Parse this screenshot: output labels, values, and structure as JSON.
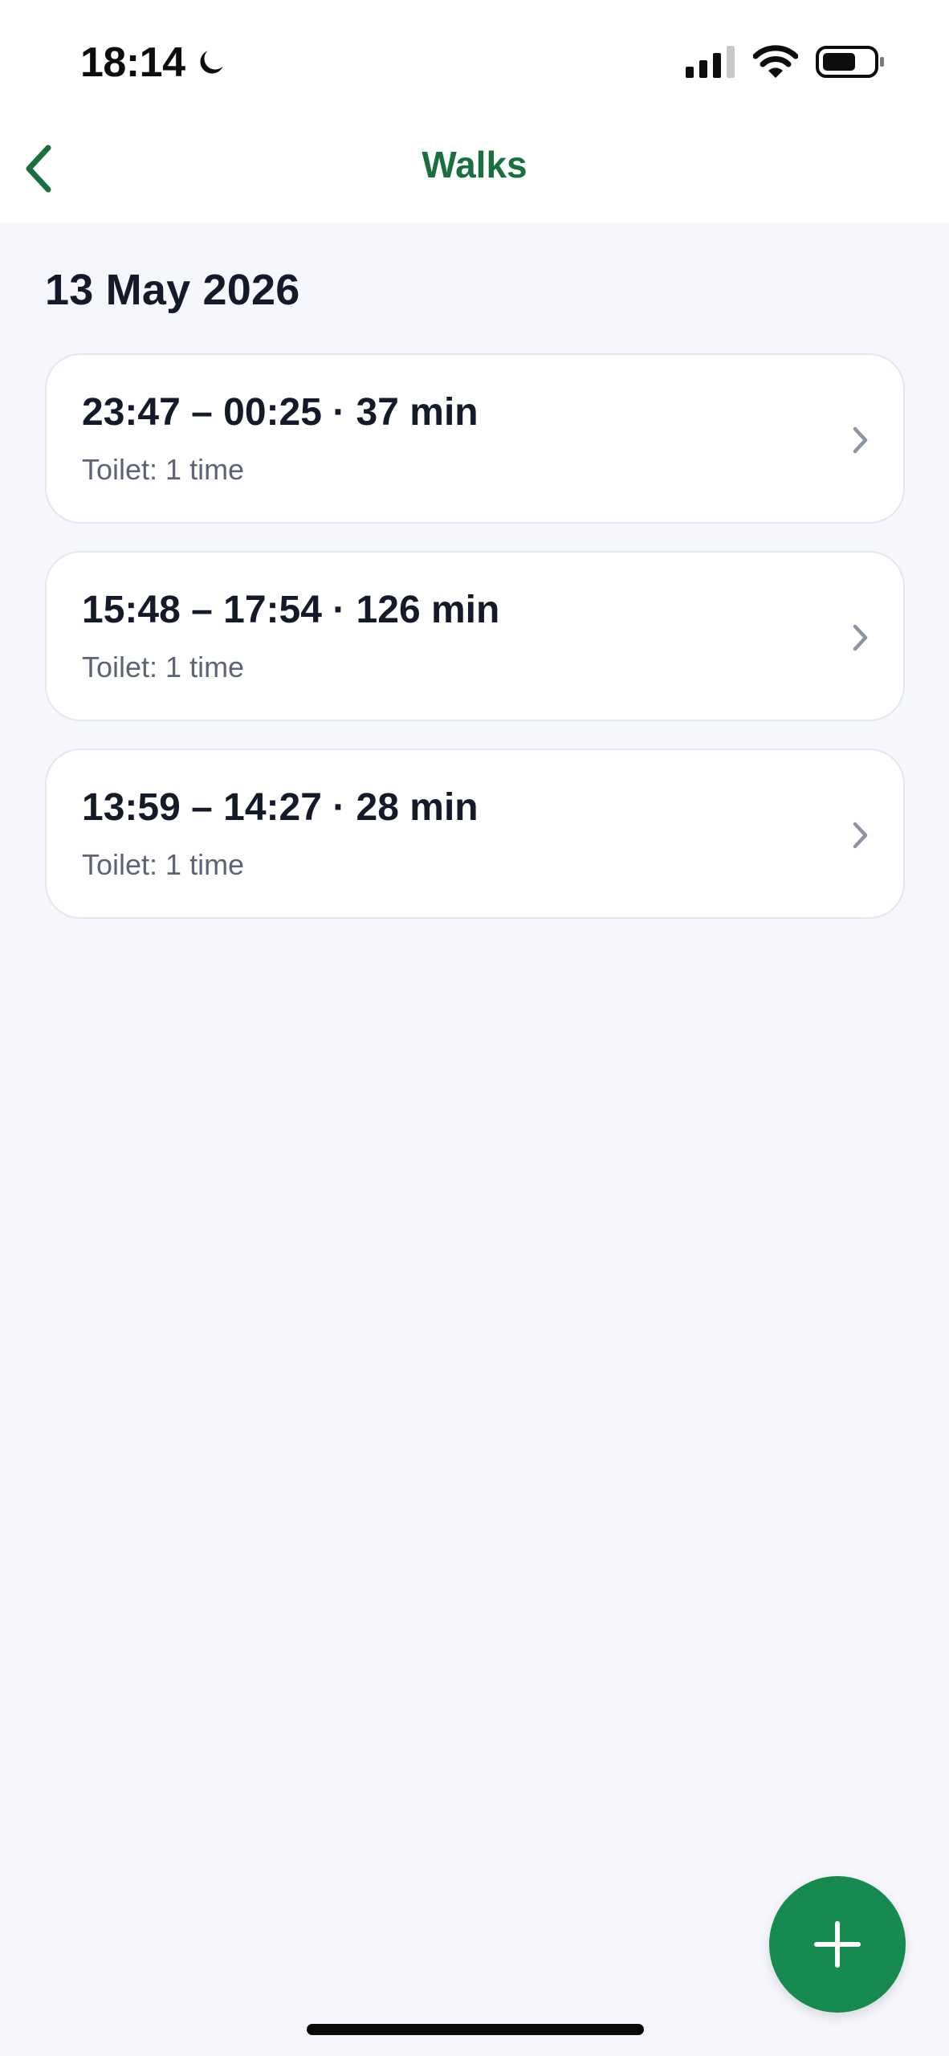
{
  "status_bar": {
    "time": "18:14",
    "icons": [
      "moon-icon",
      "signal-icon",
      "wifi-icon",
      "battery-icon"
    ]
  },
  "nav": {
    "title": "Walks",
    "back_icon": "chevron-left-icon"
  },
  "date_header": "13 May 2026",
  "walks": [
    {
      "time_range": "23:47 – 00:25 · 37 min",
      "detail": "Toilet: 1 time"
    },
    {
      "time_range": "15:48 – 17:54 · 126 min",
      "detail": "Toilet: 1 time"
    },
    {
      "time_range": "13:59 – 14:27 · 28 min",
      "detail": "Toilet: 1 time"
    }
  ],
  "fab": {
    "icon": "plus-icon"
  },
  "colors": {
    "accent": "#178a4f",
    "title_green": "#19703e",
    "background": "#f5f7fc",
    "text_primary": "#151a2b",
    "text_secondary": "#5c6475"
  }
}
